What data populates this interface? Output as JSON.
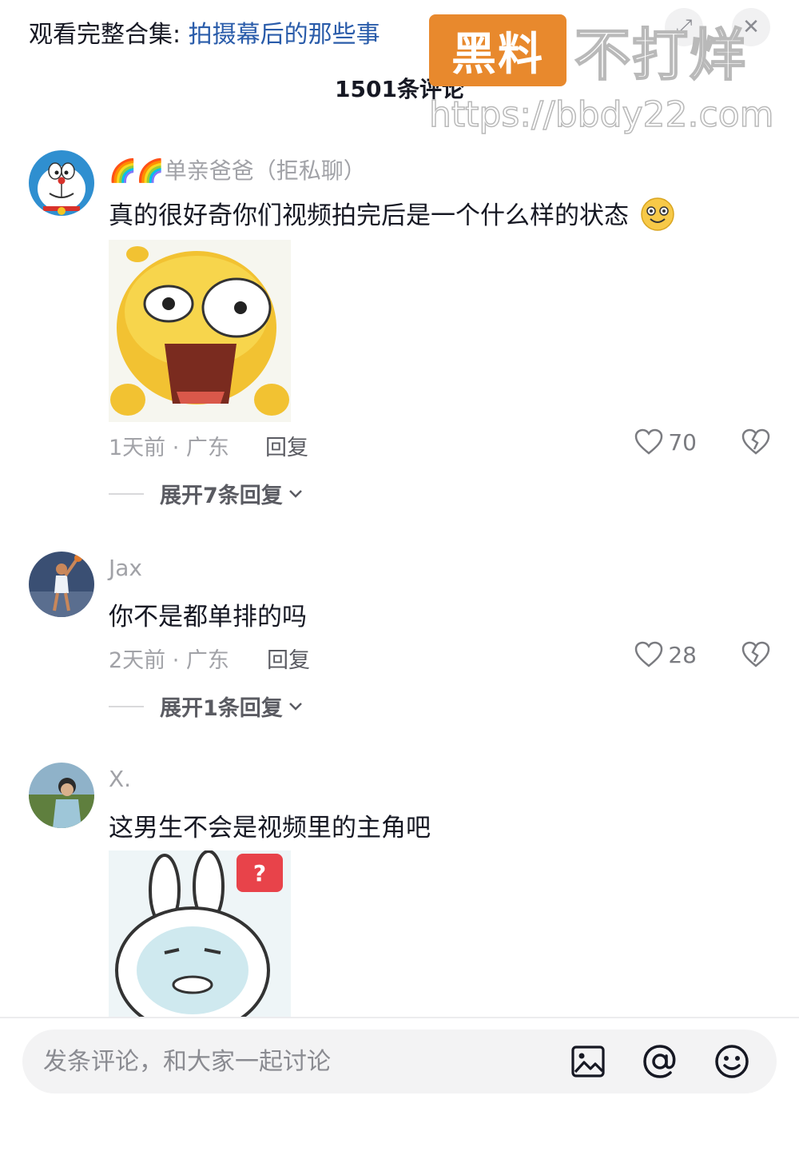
{
  "header": {
    "collection_prefix": "观看完整合集: ",
    "collection_link": "拍摄幕后的那些事",
    "comment_count_title": "1501条评论"
  },
  "watermark": {
    "box_text": "黑料",
    "text": "不打烊",
    "url": "https://bbdy22.com"
  },
  "comments": [
    {
      "username": "🌈🌈单亲爸爸（拒私聊）",
      "text": "真的很好奇你们视频拍完后是一个什么样的状态",
      "meta": "1天前 · 广东",
      "reply_label": "回复",
      "likes": "70",
      "expand_label": "展开7条回复",
      "has_sticker": true
    },
    {
      "username": "Jax",
      "text": "你不是都单排的吗",
      "meta": "2天前 · 广东",
      "reply_label": "回复",
      "likes": "28",
      "expand_label": "展开1条回复",
      "has_sticker": false
    },
    {
      "username": "X.",
      "text": "这男生不会是视频里的主角吧",
      "has_sticker": true,
      "sticker_badge": "?"
    }
  ],
  "input_bar": {
    "placeholder": "发条评论，和大家一起讨论",
    "icons": [
      "image-icon",
      "at-icon",
      "emoji-icon"
    ]
  },
  "colors": {
    "link": "#2a5caa",
    "watermark_orange": "#e8892d",
    "secondary_text": "#a1a2a7"
  }
}
